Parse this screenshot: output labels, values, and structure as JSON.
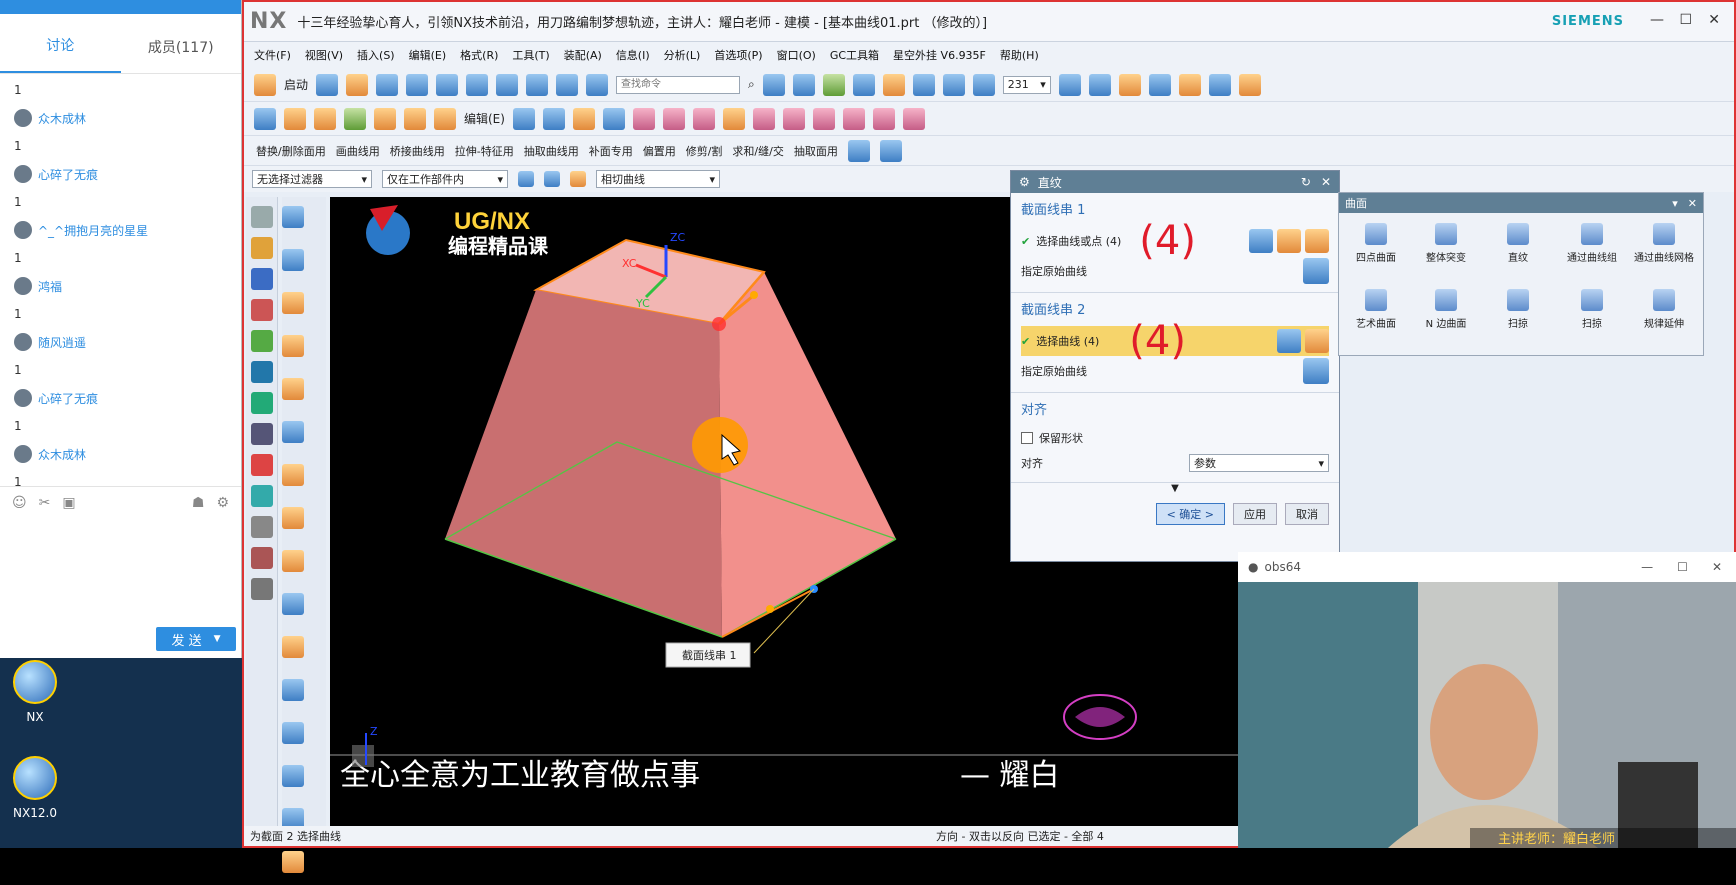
{
  "chat": {
    "tabs": [
      {
        "label": "讨论"
      },
      {
        "label": "成员(117)"
      }
    ],
    "messages": [
      {
        "user": "",
        "text": "1"
      },
      {
        "user": "众木成林",
        "text": "1"
      },
      {
        "user": "心碎了无痕",
        "text": "1"
      },
      {
        "user": "^_^拥抱月亮的星星",
        "text": "1"
      },
      {
        "user": "鸿福",
        "text": "1"
      },
      {
        "user": "随风逍遥",
        "text": "1"
      },
      {
        "user": "心碎了无痕",
        "text": "1"
      },
      {
        "user": "众木成林",
        "text": "1"
      }
    ],
    "send_label": "发 送"
  },
  "desktop": {
    "icons": [
      {
        "label": "NX"
      },
      {
        "label": "NX12.0"
      }
    ]
  },
  "window": {
    "logo": "NX",
    "title": "十三年经验挚心育人，引领NX技术前沿，用刀路编制梦想轨迹，主讲人：耀白老师 - 建模 - [基本曲线01.prt （修改的）]",
    "brand": "SIEMENS"
  },
  "menu": [
    "文件(F)",
    "视图(V)",
    "插入(S)",
    "编辑(E)",
    "格式(R)",
    "工具(T)",
    "装配(A)",
    "信息(I)",
    "分析(L)",
    "首选项(P)",
    "窗口(O)",
    "GC工具箱",
    "星空外挂 V6.935F",
    "帮助(H)"
  ],
  "toolbar": {
    "start_label": "启动",
    "search_placeholder": "查找命令",
    "zoom_value": "231",
    "edit_label": "编辑(E)"
  },
  "commands": [
    "替换/删除面用",
    "画曲线用",
    "桥接曲线用",
    "拉伸-特征用",
    "抽取曲线用",
    "补面专用",
    "偏置用",
    "修剪/割",
    "求和/缝/交",
    "抽取面用"
  ],
  "filters": {
    "type_filter": "无选择过滤器",
    "scope": "仅在工作部件内",
    "curve_rule": "相切曲线"
  },
  "graphics": {
    "logo_text": "UG/NX",
    "logo_sub": "编程精品课",
    "tooltip": "截面线串 1",
    "slogan": "全心全意为工业教育做点事",
    "author": "— 耀白",
    "axes": {
      "zc": "ZC",
      "xc": "XC",
      "yc": "YC"
    },
    "triad_z": "Z"
  },
  "status": {
    "left": "为截面 2 选择曲线",
    "right": "方向 - 双击以反向 已选定 - 全部 4"
  },
  "dialog": {
    "title": "直纹",
    "section1": {
      "title": "截面线串 1",
      "select_label": "选择曲线或点 (4)",
      "origin_label": "指定原始曲线",
      "annotation": "(4)"
    },
    "section2": {
      "title": "截面线串 2",
      "select_label": "选择曲线 (4)",
      "origin_label": "指定原始曲线",
      "annotation": "(4)"
    },
    "align": {
      "title": "对齐",
      "keep_shape": "保留形状",
      "align_label": "对齐",
      "align_value": "参数"
    },
    "ok": "< 确定 >",
    "apply": "应用",
    "cancel": "取消"
  },
  "surface_panel": {
    "title": "曲面",
    "items": [
      {
        "label": "四点曲面"
      },
      {
        "label": "整体突变"
      },
      {
        "label": "直纹"
      },
      {
        "label": "通过曲线组"
      },
      {
        "label": "通过曲线网格"
      },
      {
        "label": "艺术曲面"
      },
      {
        "label": "N 边曲面"
      },
      {
        "label": "扫掠"
      },
      {
        "label": "扫掠"
      },
      {
        "label": "规律延伸"
      }
    ]
  },
  "webcam": {
    "title": "obs64",
    "caption": "主讲老师：耀白老师"
  },
  "colors": {
    "accent": "#2e8ee0",
    "body_fill": "#f29b98",
    "edge": "#ff8a1a",
    "dialog_head": "#5f7f95"
  }
}
